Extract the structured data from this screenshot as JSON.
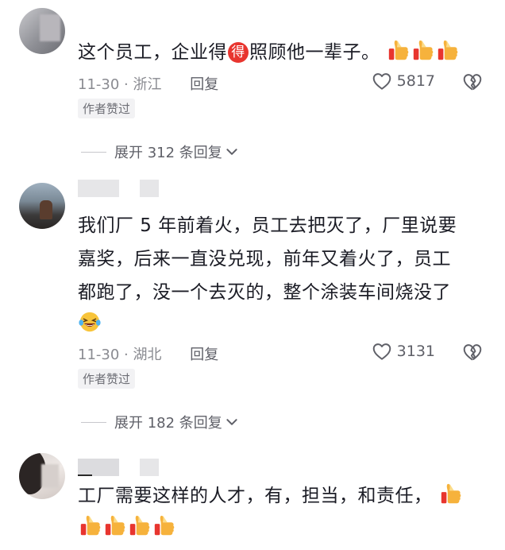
{
  "comments": [
    {
      "text_before": "这个员工，企业得",
      "inline_emoji_char": "得",
      "text_after": "照顾他一辈子。",
      "date_location": "11-30 · 浙江",
      "reply_label": "回复",
      "like_count": "5817",
      "author_badge": "作者赞过",
      "expand_label": "展开 312 条回复"
    },
    {
      "lines": [
        "我们厂 5 年前着火，员工去把灭了，厂里说要",
        "嘉奖，后来一直没兑现，前年又着火了，员工",
        "都跑了，没一个去灭的，整个涂装车间烧没了"
      ],
      "date_location": "11-30 · 湖北",
      "reply_label": "回复",
      "like_count": "3131",
      "author_badge": "作者赞过",
      "expand_label": "展开 182 条回复"
    },
    {
      "text": "工厂需要这样的人才，有，担当，和责任，"
    }
  ],
  "icons": {
    "thumbs": "thumbs-up-emoji",
    "laugh": "laughing-tears-emoji",
    "like": "heart-outline-icon",
    "dislike": "broken-heart-icon",
    "chevron": "chevron-down-icon"
  },
  "colors": {
    "emoji_red": "#e8352f",
    "thumb_yellow": "#f6b23c",
    "thumb_red": "#e8352f"
  }
}
